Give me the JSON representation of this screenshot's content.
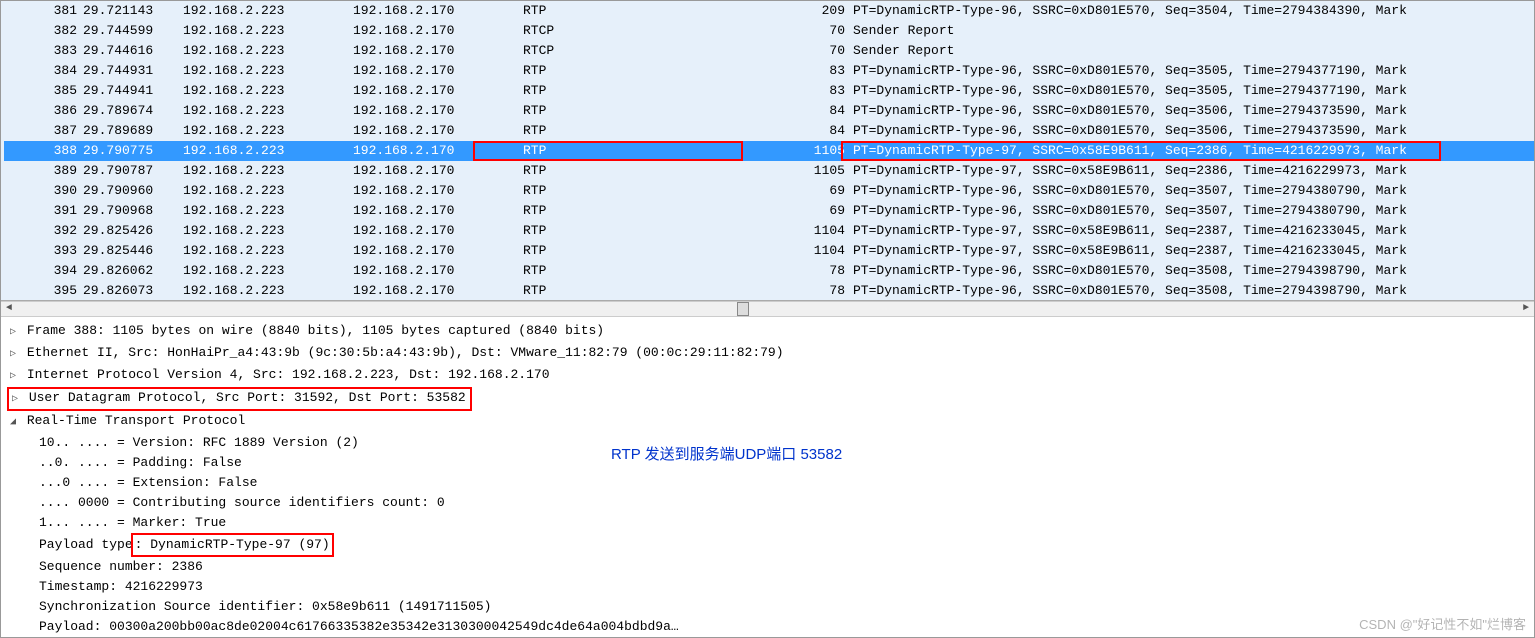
{
  "packets": [
    {
      "no": "381",
      "time": "29.721143",
      "src": "192.168.2.223",
      "dst": "192.168.2.170",
      "proto": "RTP",
      "len": "209",
      "info": "PT=DynamicRTP-Type-96, SSRC=0xD801E570, Seq=3504, Time=2794384390, Mark"
    },
    {
      "no": "382",
      "time": "29.744599",
      "src": "192.168.2.223",
      "dst": "192.168.2.170",
      "proto": "RTCP",
      "len": "70",
      "info": "Sender Report"
    },
    {
      "no": "383",
      "time": "29.744616",
      "src": "192.168.2.223",
      "dst": "192.168.2.170",
      "proto": "RTCP",
      "len": "70",
      "info": "Sender Report"
    },
    {
      "no": "384",
      "time": "29.744931",
      "src": "192.168.2.223",
      "dst": "192.168.2.170",
      "proto": "RTP",
      "len": "83",
      "info": "PT=DynamicRTP-Type-96, SSRC=0xD801E570, Seq=3505, Time=2794377190, Mark"
    },
    {
      "no": "385",
      "time": "29.744941",
      "src": "192.168.2.223",
      "dst": "192.168.2.170",
      "proto": "RTP",
      "len": "83",
      "info": "PT=DynamicRTP-Type-96, SSRC=0xD801E570, Seq=3505, Time=2794377190, Mark"
    },
    {
      "no": "386",
      "time": "29.789674",
      "src": "192.168.2.223",
      "dst": "192.168.2.170",
      "proto": "RTP",
      "len": "84",
      "info": "PT=DynamicRTP-Type-96, SSRC=0xD801E570, Seq=3506, Time=2794373590, Mark"
    },
    {
      "no": "387",
      "time": "29.789689",
      "src": "192.168.2.223",
      "dst": "192.168.2.170",
      "proto": "RTP",
      "len": "84",
      "info": "PT=DynamicRTP-Type-96, SSRC=0xD801E570, Seq=3506, Time=2794373590, Mark"
    },
    {
      "no": "388",
      "time": "29.790775",
      "src": "192.168.2.223",
      "dst": "192.168.2.170",
      "proto": "RTP",
      "len": "1105",
      "info": "PT=DynamicRTP-Type-97, SSRC=0x58E9B611, Seq=2386, Time=4216229973, Mark",
      "selected": true
    },
    {
      "no": "389",
      "time": "29.790787",
      "src": "192.168.2.223",
      "dst": "192.168.2.170",
      "proto": "RTP",
      "len": "1105",
      "info": "PT=DynamicRTP-Type-97, SSRC=0x58E9B611, Seq=2386, Time=4216229973, Mark"
    },
    {
      "no": "390",
      "time": "29.790960",
      "src": "192.168.2.223",
      "dst": "192.168.2.170",
      "proto": "RTP",
      "len": "69",
      "info": "PT=DynamicRTP-Type-96, SSRC=0xD801E570, Seq=3507, Time=2794380790, Mark"
    },
    {
      "no": "391",
      "time": "29.790968",
      "src": "192.168.2.223",
      "dst": "192.168.2.170",
      "proto": "RTP",
      "len": "69",
      "info": "PT=DynamicRTP-Type-96, SSRC=0xD801E570, Seq=3507, Time=2794380790, Mark"
    },
    {
      "no": "392",
      "time": "29.825426",
      "src": "192.168.2.223",
      "dst": "192.168.2.170",
      "proto": "RTP",
      "len": "1104",
      "info": "PT=DynamicRTP-Type-97, SSRC=0x58E9B611, Seq=2387, Time=4216233045, Mark"
    },
    {
      "no": "393",
      "time": "29.825446",
      "src": "192.168.2.223",
      "dst": "192.168.2.170",
      "proto": "RTP",
      "len": "1104",
      "info": "PT=DynamicRTP-Type-97, SSRC=0x58E9B611, Seq=2387, Time=4216233045, Mark"
    },
    {
      "no": "394",
      "time": "29.826062",
      "src": "192.168.2.223",
      "dst": "192.168.2.170",
      "proto": "RTP",
      "len": "78",
      "info": "PT=DynamicRTP-Type-96, SSRC=0xD801E570, Seq=3508, Time=2794398790, Mark"
    },
    {
      "no": "395",
      "time": "29.826073",
      "src": "192.168.2.223",
      "dst": "192.168.2.170",
      "proto": "RTP",
      "len": "78",
      "info": "PT=DynamicRTP-Type-96, SSRC=0xD801E570, Seq=3508, Time=2794398790, Mark"
    }
  ],
  "details": {
    "frame": "Frame 388: 1105 bytes on wire (8840 bits), 1105 bytes captured (8840 bits)",
    "ethernet": "Ethernet II, Src: HonHaiPr_a4:43:9b (9c:30:5b:a4:43:9b), Dst: VMware_11:82:79 (00:0c:29:11:82:79)",
    "ip": "Internet Protocol Version 4, Src: 192.168.2.223, Dst: 192.168.2.170",
    "udp": "User Datagram Protocol, Src Port: 31592, Dst Port: 53582",
    "rtp_header": "Real-Time Transport Protocol",
    "rtp_fields": {
      "version": "10.. .... = Version: RFC 1889 Version (2)",
      "padding": "..0. .... = Padding: False",
      "extension": "...0 .... = Extension: False",
      "csrc": ".... 0000 = Contributing source identifiers count: 0",
      "marker": "1... .... = Marker: True",
      "payload_type_prefix": "Payload type",
      "payload_type_value": ": DynamicRTP-Type-97 (97)",
      "seq": "Sequence number: 2386",
      "ts": "Timestamp: 4216229973",
      "ssrc": "Synchronization Source identifier: 0x58e9b611 (1491711505)",
      "payload": "Payload: 00300a200bb00ac8de02004c61766335382e35342e3130300042549dc4de64a004bdbd9a…"
    }
  },
  "annotation": "RTP 发送到服务端UDP端口 53582",
  "watermark": "CSDN @\"好记性不如\"烂博客"
}
